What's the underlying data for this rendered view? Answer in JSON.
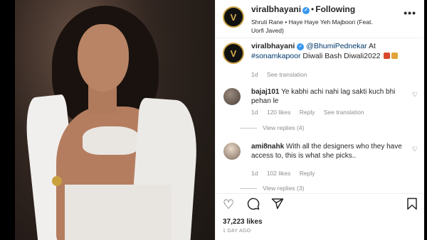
{
  "colors": {
    "accent_link": "#00376b",
    "verified": "#3897f0",
    "secondary_text": "#8e8e8e",
    "logo_gold": "#c8a246"
  },
  "post": {
    "image_alt": "photo-of-woman-in-white-saree",
    "header": {
      "username": "viralbhayani",
      "follow_status": "Following",
      "audio": "Shruti Rane • Haye Haye Yeh Majboori (Feat. Uorfi Javed)",
      "logo_letter": "V"
    },
    "caption": {
      "username": "viralbhayani",
      "mention": "@BhumiPednekar",
      "text_1": " At ",
      "hashtag": "#sonamkapoor",
      "text_2": " Diwali Bash Diwali2022",
      "age": "1d",
      "see_translation": "See translation"
    },
    "comments": [
      {
        "username": "bajaj101",
        "text": "Ye kabhi achi nahi lag sakti kuch bhi pehan le",
        "age": "1d",
        "likes": "120 likes",
        "reply": "Reply",
        "see_translation": "See translation",
        "view_replies": "View replies (4)"
      },
      {
        "username": "ami8nahk",
        "text": "With all the designers who they have access to, this is what she picks..",
        "age": "1d",
        "likes": "102 likes",
        "reply": "Reply",
        "view_replies": "View replies (3)"
      }
    ],
    "likes_count": "37,223 likes",
    "timestamp": "1 DAY AGO"
  }
}
